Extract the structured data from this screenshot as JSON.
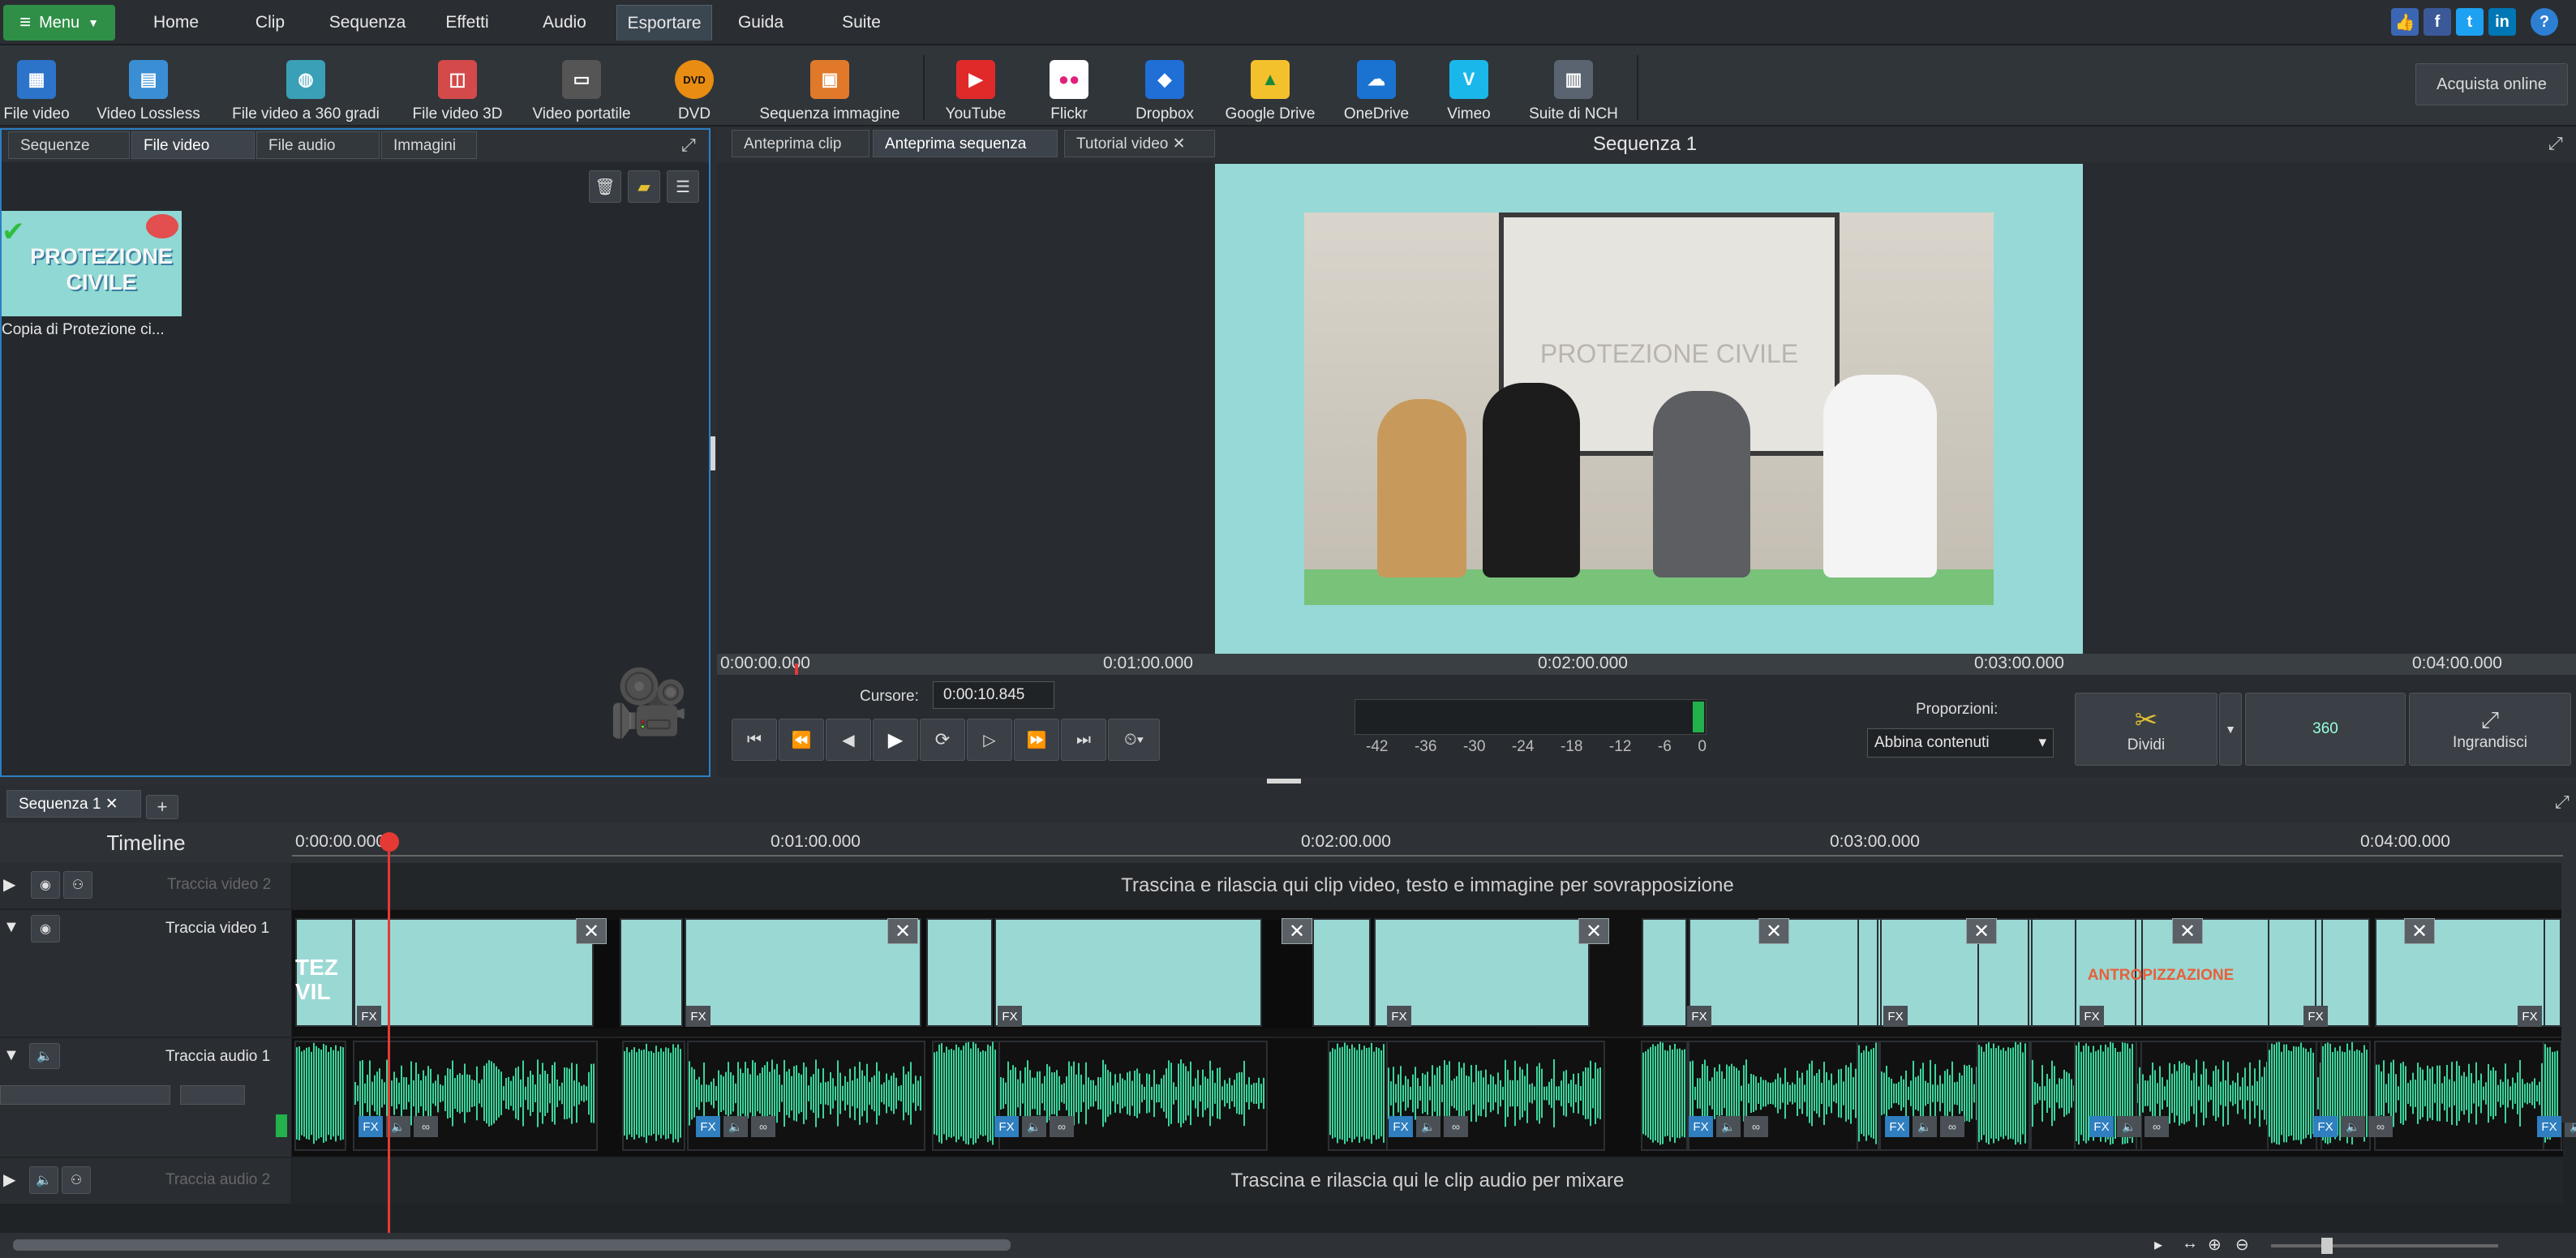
{
  "menubar": {
    "menu_label": "Menu",
    "tabs": [
      "Home",
      "Clip",
      "Sequenza",
      "Effetti",
      "Audio",
      "Esportare",
      "Guida",
      "Suite"
    ],
    "active_tab": "Esportare"
  },
  "toolbar": {
    "items": [
      "File video",
      "Video Lossless",
      "File video a 360 gradi",
      "File video 3D",
      "Video portatile",
      "DVD",
      "Sequenza immagine",
      "YouTube",
      "Flickr",
      "Dropbox",
      "Google Drive",
      "OneDrive",
      "Vimeo",
      "Suite di NCH"
    ],
    "buy_label": "Acquista online",
    "dvd_badge": "DVD"
  },
  "media_bin": {
    "tabs": [
      "Sequenze",
      "File video",
      "File audio",
      "Immagini"
    ],
    "active_tab": "File video",
    "clip_name": "Copia di Protezione ci...",
    "thumb_text": [
      "PROTEZIONE",
      "CIVILE"
    ]
  },
  "preview": {
    "tabs": [
      "Anteprima clip",
      "Anteprima sequenza",
      "Tutorial video"
    ],
    "active_tab": "Anteprima sequenza",
    "title": "Sequenza 1",
    "ruler": [
      "0:00:00.000",
      "0:01:00.000",
      "0:02:00.000",
      "0:03:00.000",
      "0:04:00.000"
    ],
    "cursor_label": "Cursore:",
    "cursor_value": "0:00:10.845",
    "meter_ticks": [
      "-42",
      "-36",
      "-30",
      "-24",
      "-18",
      "-12",
      "-6",
      "0"
    ],
    "proportions_label": "Proporzioni:",
    "proportions_value": "Abbina contenuti",
    "split_label": "Dividi",
    "btn360_label": "360",
    "zoom_label": "Ingrandisci",
    "video_text": "PROTEZIONE CIVILE"
  },
  "timeline": {
    "sequence_tab": "Sequenza 1",
    "label": "Timeline",
    "ruler": [
      "0:00:00.000",
      "0:01:00.000",
      "0:02:00.000",
      "0:03:00.000",
      "0:04:00.000"
    ],
    "tracks": {
      "video2": "Traccia video 2",
      "video1": "Traccia video 1",
      "audio1": "Traccia audio 1",
      "audio2": "Traccia audio 2"
    },
    "overlay_hint": "Trascina e rilascia qui clip video, testo e immagine per sovrapposizione",
    "audio_hint": "Trascina e rilascia qui le clip audio per mixare",
    "first_clip_text": [
      "TEZ",
      "VIL"
    ],
    "title_clip_text": "ANTROPIZZAZIONE",
    "fx_label": "FX",
    "playhead_seconds": 10.845
  },
  "colors": {
    "accent_green": "#2f8f47",
    "waveform": "#3bd49a",
    "playhead": "#e53935",
    "clip_bg": "#9ad8d4"
  }
}
